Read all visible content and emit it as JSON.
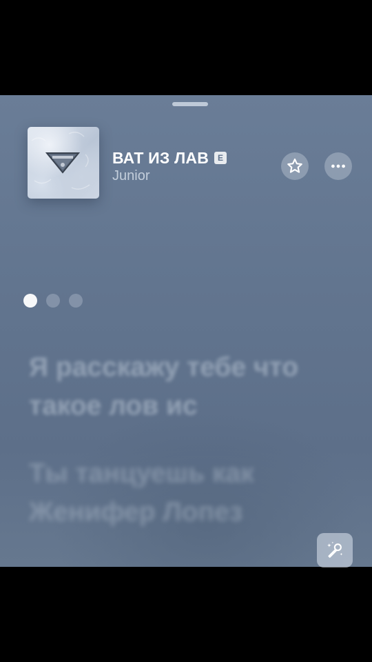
{
  "now_playing": {
    "title": "ВАТ ИЗ ЛАВ",
    "explicit_badge": "E",
    "artist": "Junior"
  },
  "lyrics": {
    "pages_total": 3,
    "active_page": 1,
    "lines": [
      "Я расскажу тебе что такое лов ис",
      "Ты танцуешь как Женифер Лопез"
    ]
  },
  "icons": {
    "favorite": "star-outline-icon",
    "more": "ellipsis-icon",
    "lyrics_mode": "microphone-sparkle-icon"
  },
  "colors": {
    "sheet_background": "#62758f",
    "primary_text": "#ffffff",
    "secondary_text": "#dfe6ef"
  }
}
